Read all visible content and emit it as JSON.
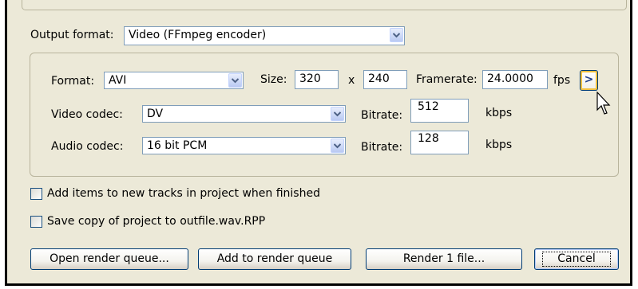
{
  "output": {
    "label": "Output format:",
    "value": "Video (FFmpeg encoder)"
  },
  "video": {
    "format": {
      "label": "Format:",
      "value": "AVI"
    },
    "size": {
      "label": "Size:",
      "width": "320",
      "separator": "x",
      "height": "240"
    },
    "framerate": {
      "label": "Framerate:",
      "value": "24.0000",
      "unit": "fps",
      "more_button": ">"
    },
    "video_codec": {
      "label": "Video codec:",
      "value": "DV",
      "bitrate_label": "Bitrate:",
      "bitrate": "512",
      "unit": "kbps"
    },
    "audio_codec": {
      "label": "Audio codec:",
      "value": "16 bit PCM",
      "bitrate_label": "Bitrate:",
      "bitrate": "128",
      "unit": "kbps"
    }
  },
  "options": {
    "add_items": {
      "label": "Add items to new tracks in project when finished",
      "checked": false
    },
    "save_copy": {
      "label": "Save copy of project to outfile.wav.RPP",
      "checked": false
    }
  },
  "buttons": {
    "open_queue": "Open render queue...",
    "add_queue": "Add to render queue",
    "render": "Render 1 file...",
    "cancel": "Cancel"
  },
  "colors": {
    "dialog_bg": "#ece9d8",
    "field_border": "#7f9db9",
    "button_border": "#003c74",
    "highlight": "#f0c040"
  }
}
